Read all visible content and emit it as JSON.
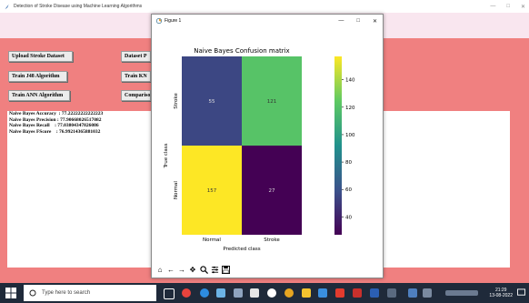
{
  "app": {
    "title": "Detection of Stroke Disease using Machine Learning Algorithms",
    "controls": [
      "—",
      "□",
      "✕"
    ],
    "buttons": {
      "upload": "Upload Stroke Dataset",
      "dataset_partial": "Dataset P",
      "j48": "Train J48 Algorithm",
      "knn_partial": "Train KN",
      "ann": "Train ANN Algorithm",
      "comparison_partial": "Compariso"
    },
    "output_lines": [
      "Naive Bayes Accuracy  : 77.22222222222223",
      "Naive Bayes Precision : 77.90668026517082",
      "Naive Bayes Recall    : 77.03804347826086",
      "Naive Bayes FScore    : 76.99214365881032"
    ]
  },
  "figure": {
    "window_title": "Figure 1",
    "controls": [
      "—",
      "□",
      "✕"
    ],
    "toolbar": [
      "home",
      "back",
      "forward",
      "pan",
      "zoom",
      "configure",
      "save"
    ]
  },
  "chart_data": {
    "type": "heatmap",
    "title": "Naive Bayes Confusion matrix",
    "xlabel": "Predicted class",
    "ylabel": "True class",
    "x_categories": [
      "Normal",
      "Stroke"
    ],
    "y_categories": [
      "Stroke",
      "Normal"
    ],
    "values": [
      [
        55,
        121
      ],
      [
        157,
        27
      ]
    ],
    "colorbar_ticks": [
      40,
      60,
      80,
      100,
      120,
      140
    ],
    "colormap": "viridis",
    "vmin": 27,
    "vmax": 157
  },
  "taskbar": {
    "search_placeholder": "Type here to search",
    "time": "21:29",
    "date": "13-08-2022"
  }
}
